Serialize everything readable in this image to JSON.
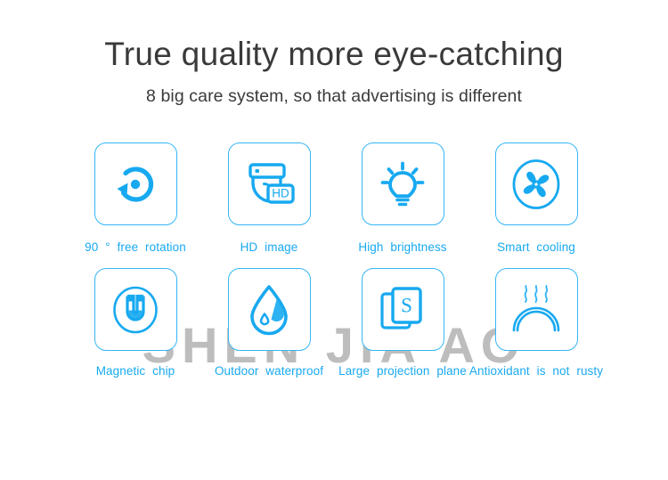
{
  "banner": {
    "title": "True quality more eye-catching",
    "subtitle": "8 big care system, so that advertising is different",
    "watermark": "SHEN JIA AO",
    "colors": {
      "accent": "#17a9f0",
      "card_border": "#35b6f5",
      "title_text": "#3a3a3a",
      "watermark": "#bdbdbd",
      "background": "#ffffff"
    }
  },
  "features": [
    {
      "icon": "rotation-icon",
      "label": "90 ° free  rotation"
    },
    {
      "icon": "hd-camera-icon",
      "label": "HD  image",
      "badge": "HD"
    },
    {
      "icon": "lightbulb-icon",
      "label": "High  brightness"
    },
    {
      "icon": "fan-icon",
      "label": "Smart  cooling"
    },
    {
      "icon": "magnet-icon",
      "label": "Magnetic  chip"
    },
    {
      "icon": "water-drop-icon",
      "label": "Outdoor  waterproof"
    },
    {
      "icon": "layers-icon",
      "label": "Large  projection  plane",
      "badge": "S"
    },
    {
      "icon": "heat-dome-icon",
      "label": "Antioxidant  is  not  rusty"
    }
  ]
}
